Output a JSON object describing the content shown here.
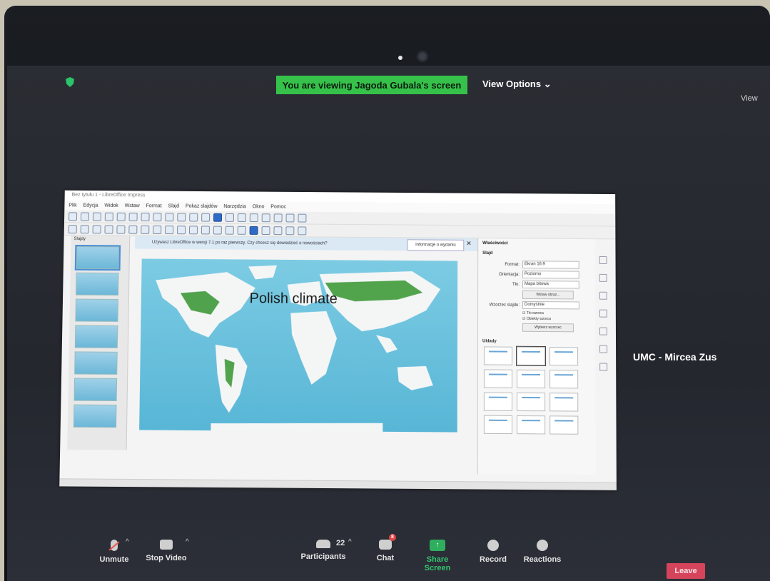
{
  "zoom": {
    "viewing_banner": "You are viewing Jagoda Gubala's screen",
    "view_options": "View Options ⌄",
    "view_right": "View",
    "participant_name": "UMC - Mircea Zus",
    "toolbar": {
      "unmute": "Unmute",
      "stop_video": "Stop Video",
      "participants": "Participants",
      "participants_count": "22",
      "chat": "Chat",
      "chat_badge": "8",
      "share_screen": "Share Screen",
      "record": "Record",
      "reactions": "Reactions",
      "leave": "Leave"
    },
    "colors": {
      "banner": "#36c24a",
      "leave": "#d5445a",
      "share": "#2fae5e"
    }
  },
  "libreoffice": {
    "title": "Bez tytułu 1 - LibreOffice Impress",
    "menu": [
      "Plik",
      "Edycja",
      "Widok",
      "Wstaw",
      "Format",
      "Slajd",
      "Pokaz slajdów",
      "Narzędzia",
      "Okno",
      "Pomoc"
    ],
    "slides_label": "Slajdy",
    "info_text": "Używasz LibreOffice w wersji 7.1 po raz pierwszy. Czy chcesz się dowiedzieć o nowościach?",
    "info_button": "Informacje o wydaniu",
    "slide_title": "Polish climate",
    "properties": {
      "title": "Właściwości",
      "section": "Slajd",
      "format_label": "Format:",
      "format_value": "Ekran 16:9",
      "orientation_label": "Orientacja:",
      "orientation_value": "Poziomo",
      "background_label": "Tło:",
      "background_value": "Mapa bitowa",
      "insert_image": "Wstaw obraz...",
      "master_label": "Wzorzec slajdu:",
      "master_value": "Domyślnie",
      "check_master": "Tło wzorca",
      "check_objects": "Obiekty wzorca",
      "select_master": "Wybierz wzorzec",
      "layouts_label": "Układy"
    }
  }
}
